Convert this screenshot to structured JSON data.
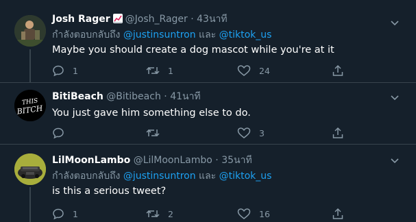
{
  "tweets": [
    {
      "name": "Josh Rager",
      "badge": "chart-increasing-emoji",
      "handle": "@Josh_Rager",
      "separator": "·",
      "time": "43นาที",
      "replying_prefix": "กำลังตอบกลับถึง",
      "mention1": "@justinsuntron",
      "conj": "และ",
      "mention2": "@tiktok_us",
      "text": "Maybe you should create a dog mascot while you're at it",
      "replies": "1",
      "retweets": "1",
      "likes": "24"
    },
    {
      "name": "BitiBeach",
      "handle": "@Bitibeach",
      "separator": "·",
      "time": "41นาที",
      "avatar_text_line1": "THIS",
      "avatar_text_line2": "BITCH",
      "text": "You just gave him something else to do.",
      "replies": "",
      "retweets": "",
      "likes": "3"
    },
    {
      "name": "LilMoonLambo",
      "handle": "@LilMoonLambo",
      "separator": "·",
      "time": "35นาที",
      "replying_prefix": "กำลังตอบกลับถึง",
      "mention1": "@justinsuntron",
      "conj": "และ",
      "mention2": "@tiktok_us",
      "text": "is this a serious tweet?",
      "replies": "1",
      "retweets": "2",
      "likes": "16"
    }
  ],
  "colors": {
    "background": "#15202b",
    "divider": "#38444d",
    "secondary_text": "#8899a6",
    "link": "#1da1f2"
  }
}
